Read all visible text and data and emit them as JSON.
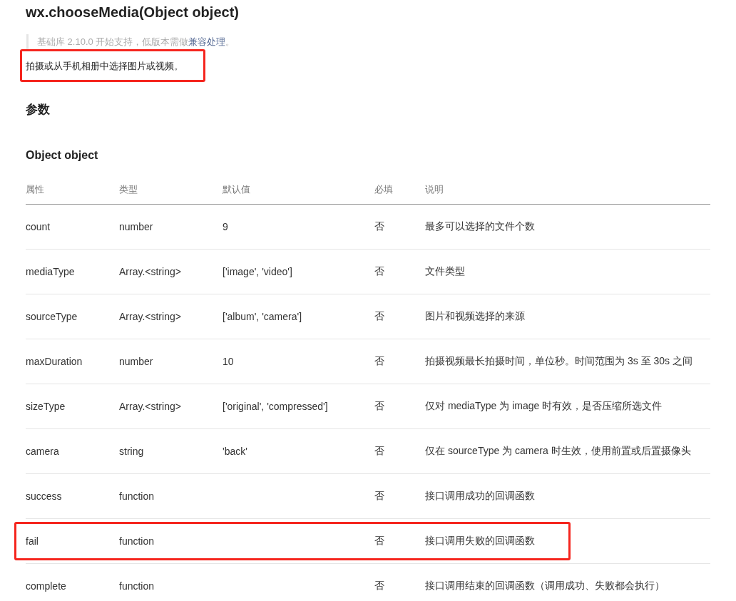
{
  "title": "wx.chooseMedia(Object object)",
  "note": {
    "before": "基础库 2.10.0 开始支持，低版本需做",
    "link": "兼容处理",
    "after": "。"
  },
  "description": {
    "text": "拍摄或从手机相册中选择图片或视频。",
    "highlighted": true
  },
  "section_heading": "参数",
  "subheading": "Object object",
  "table": {
    "columns": [
      "属性",
      "类型",
      "默认值",
      "必填",
      "说明"
    ],
    "rows": [
      {
        "cells": [
          "count",
          "number",
          "9",
          "否",
          "最多可以选择的文件个数"
        ],
        "highlighted": false
      },
      {
        "cells": [
          "mediaType",
          "Array.<string>",
          "['image', 'video']",
          "否",
          "文件类型"
        ],
        "highlighted": false
      },
      {
        "cells": [
          "sourceType",
          "Array.<string>",
          "['album', 'camera']",
          "否",
          "图片和视频选择的来源"
        ],
        "highlighted": false
      },
      {
        "cells": [
          "maxDuration",
          "number",
          "10",
          "否",
          "拍摄视频最长拍摄时间，单位秒。时间范围为 3s 至 30s 之间"
        ],
        "highlighted": false
      },
      {
        "cells": [
          "sizeType",
          "Array.<string>",
          "['original', 'compressed']",
          "否",
          "仅对 mediaType 为 image 时有效，是否压缩所选文件"
        ],
        "highlighted": false
      },
      {
        "cells": [
          "camera",
          "string",
          "'back'",
          "否",
          "仅在 sourceType 为 camera 时生效，使用前置或后置摄像头"
        ],
        "highlighted": false
      },
      {
        "cells": [
          "success",
          "function",
          "",
          "否",
          "接口调用成功的回调函数"
        ],
        "highlighted": false
      },
      {
        "cells": [
          "fail",
          "function",
          "",
          "否",
          "接口调用失败的回调函数"
        ],
        "highlighted": true
      },
      {
        "cells": [
          "complete",
          "function",
          "",
          "否",
          "接口调用结束的回调函数（调用成功、失败都会执行）"
        ],
        "highlighted": false
      }
    ]
  }
}
